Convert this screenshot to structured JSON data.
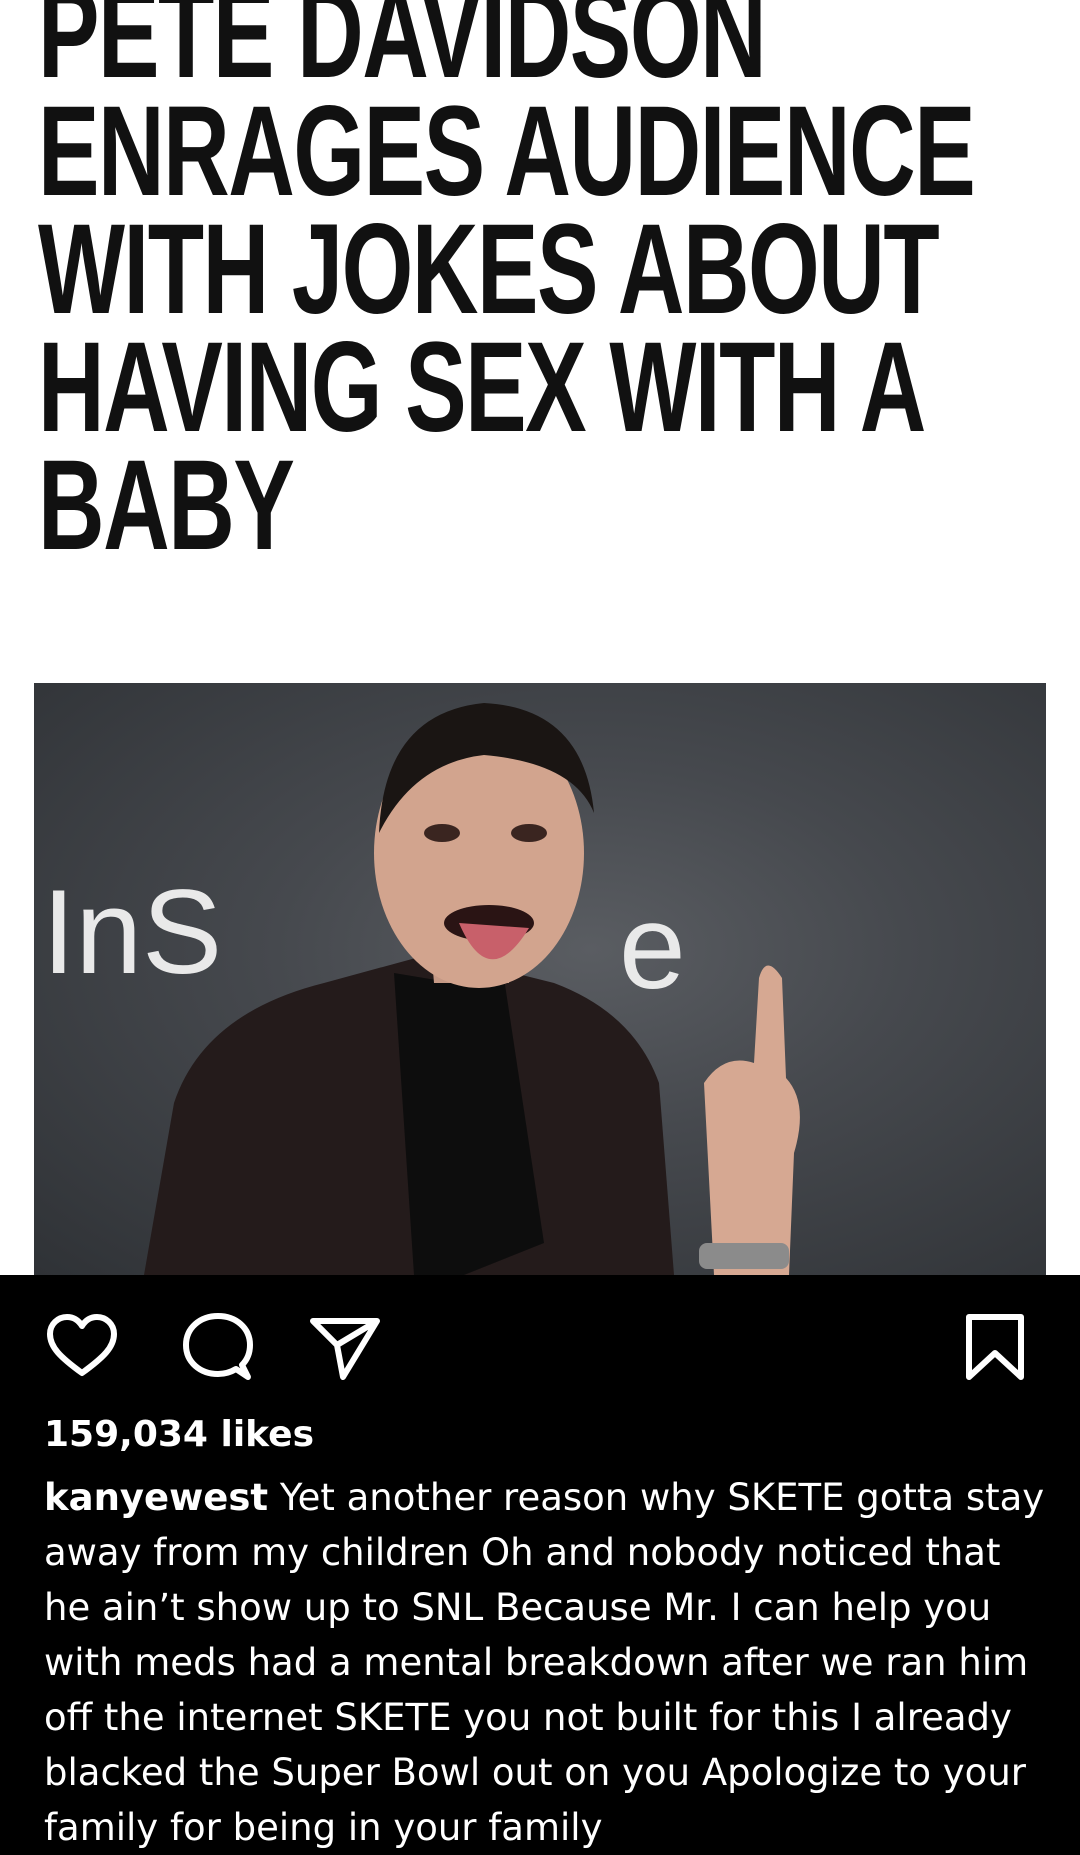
{
  "headline": {
    "lines": [
      "PETE DAVIDSON",
      "ENRAGES AUDIENCE",
      "WITH JOKES ABOUT",
      "HAVING SEX WITH A",
      "BABY"
    ]
  },
  "photo": {
    "backdrop_logo_fragment": "InS",
    "backdrop_logo_fragment_end": "e"
  },
  "actions": {
    "like_icon": "heart-icon",
    "comment_icon": "comment-icon",
    "share_icon": "send-icon",
    "save_icon": "bookmark-icon"
  },
  "post": {
    "likes": "159,034 likes",
    "username": "kanyewest",
    "caption_lines": [
      " Yet another reason why SKETE gotta stay",
      "away from my children  Oh and nobody noticed that",
      "he ain’t show up to SNL  Because Mr. I can help you",
      "with meds had a mental breakdown after we ran him",
      "off the internet  SKETE you not built for this  I already",
      "blacked the Super Bowl out on you  Apologize to your",
      "family for being in your family"
    ]
  },
  "colors": {
    "background": "#000000",
    "headline_panel": "#ffffff",
    "headline_text": "#111111",
    "icon_stroke": "#ffffff"
  }
}
